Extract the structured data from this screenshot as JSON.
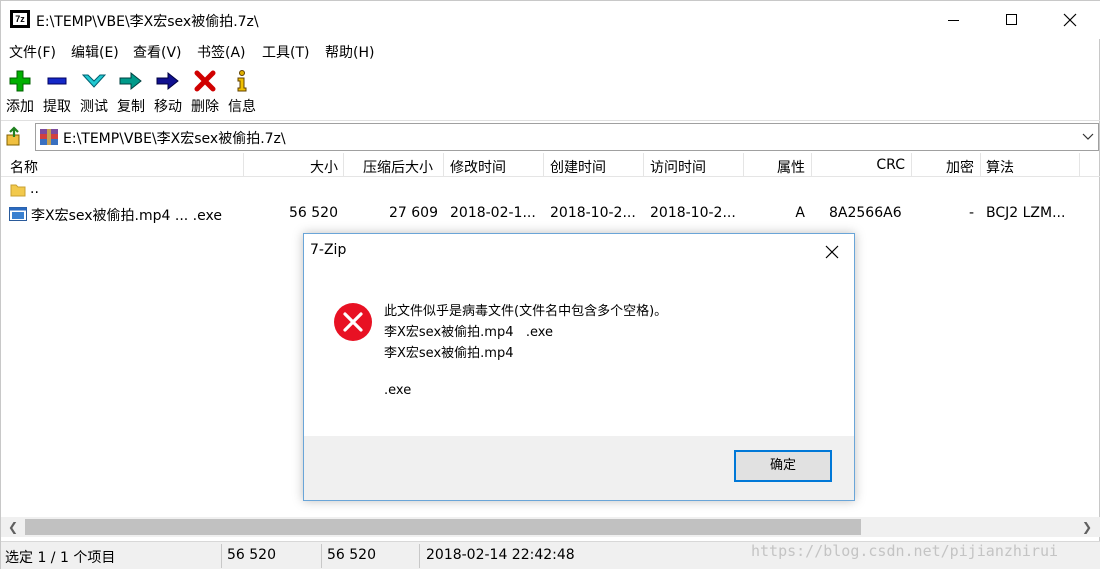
{
  "window": {
    "title": "E:\\TEMP\\VBE\\李X宏sex被偷拍.7z\\",
    "app_icon": "7z"
  },
  "menu": [
    "文件(F)",
    "编辑(E)",
    "查看(V)",
    "书签(A)",
    "工具(T)",
    "帮助(H)"
  ],
  "toolbar": [
    {
      "label": "添加",
      "icon": "add-icon",
      "color": "#00a000"
    },
    {
      "label": "提取",
      "icon": "extract-icon",
      "color": "#0000c8"
    },
    {
      "label": "测试",
      "icon": "test-icon",
      "color": "#00b8c0"
    },
    {
      "label": "复制",
      "icon": "copy-icon",
      "color": "#008080"
    },
    {
      "label": "移动",
      "icon": "move-icon",
      "color": "#000080"
    },
    {
      "label": "删除",
      "icon": "delete-icon",
      "color": "#c00000"
    },
    {
      "label": "信息",
      "icon": "info-icon",
      "color": "#d0a000"
    }
  ],
  "address": {
    "path": "E:\\TEMP\\VBE\\李X宏sex被偷拍.7z\\"
  },
  "columns": {
    "name": "名称",
    "size": "大小",
    "packed": "压缩后大小",
    "modified": "修改时间",
    "created": "创建时间",
    "accessed": "访问时间",
    "attr": "属性",
    "crc": "CRC",
    "encrypted": "加密",
    "method": "算法"
  },
  "rows": [
    {
      "name": ".."
    },
    {
      "name": "李X宏sex被偷拍.mp4 ... .exe",
      "size": "56 520",
      "packed": "27 609",
      "modified": "2018-02-1...",
      "created": "2018-10-2...",
      "accessed": "2018-10-2...",
      "attr": "A",
      "crc": "8A2566A6",
      "encrypted": "-",
      "method": "BCJ2 LZM..."
    }
  ],
  "status": {
    "selection": "选定 1 / 1 个项目",
    "size": "56 520",
    "packed": "56 520",
    "date": "2018-02-14 22:42:48"
  },
  "watermark": "https://blog.csdn.net/pijianzhirui",
  "dialog": {
    "title": "7-Zip",
    "lines": [
      "此文件似乎是病毒文件(文件名中包含多个空格)。",
      "李X宏sex被偷拍.mp4   .exe",
      "李X宏sex被偷拍.mp4",
      "",
      ".exe"
    ],
    "ok_label": "确定",
    "error_color": "#e81123"
  }
}
